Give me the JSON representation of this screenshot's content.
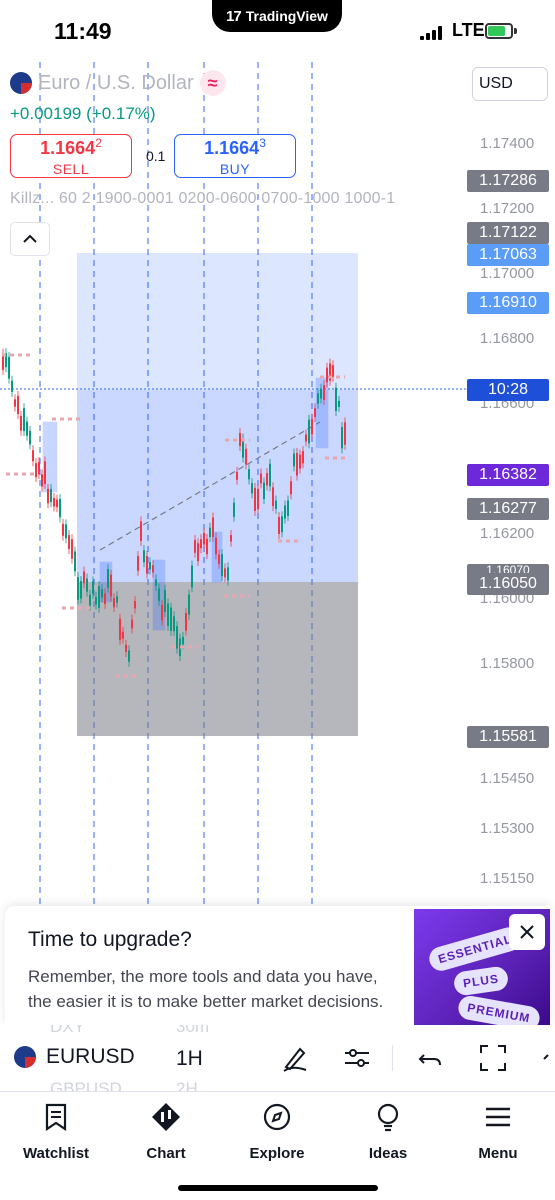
{
  "status_bar": {
    "time": "11:49",
    "app_pill": "TradingView",
    "network": "LTE"
  },
  "chart": {
    "symbol_name": "Euro / U.S. Dollar",
    "change": "+0.00199 (+0.17%)",
    "sell_price_main": "1.1664",
    "sell_price_small": "2",
    "sell_label": "SELL",
    "buy_price_main": "1.1664",
    "buy_price_small": "3",
    "buy_label": "BUY",
    "spread": "0.1",
    "indicator_text": "Killz...  60 2 1900-0001 0200-0600 0700-1000 1000-1",
    "currency": "USD",
    "price_axis": [
      "1.17400",
      "1.17200",
      "1.17000",
      "1.16800",
      "1.16600",
      "1.16200",
      "1.16000",
      "1.15800",
      "1.15450",
      "1.15300",
      "1.15150"
    ],
    "price_tags": [
      {
        "label": "1.17286",
        "color": "#787b86"
      },
      {
        "label": "1.17122",
        "color": "#787b86"
      },
      {
        "label": "1.17063",
        "color": "#5b9cf6"
      },
      {
        "label": "1.16910",
        "color": "#5b9cf6"
      },
      {
        "label": "10:28",
        "color": "#2962ff"
      },
      {
        "label": "1.16382",
        "color": "#6d28d9"
      },
      {
        "label": "1.16277",
        "color": "#787b86"
      },
      {
        "label": "1.16070",
        "color": "#787b86"
      },
      {
        "label": "1.16050",
        "color": "#787b86"
      },
      {
        "label": "1.15581",
        "color": "#787b86"
      }
    ]
  },
  "upgrade": {
    "title": "Time to upgrade?",
    "body": "Remember, the more tools and data you have, the easier it is to make better market decisions.",
    "chips": [
      "ESSENTIAL",
      "PLUS",
      "PREMIUM"
    ]
  },
  "toolbar": {
    "symbol": "EURUSD",
    "interval": "1H",
    "ghost_symbol_above": "DXY",
    "ghost_interval_above": "30m",
    "ghost_symbol_below": "GBPUSD",
    "ghost_interval_below": "2H"
  },
  "tabs": [
    {
      "label": "Watchlist",
      "icon": "watchlist-icon"
    },
    {
      "label": "Chart",
      "icon": "chart-icon"
    },
    {
      "label": "Explore",
      "icon": "compass-icon"
    },
    {
      "label": "Ideas",
      "icon": "lightbulb-icon"
    },
    {
      "label": "Menu",
      "icon": "menu-icon"
    }
  ]
}
